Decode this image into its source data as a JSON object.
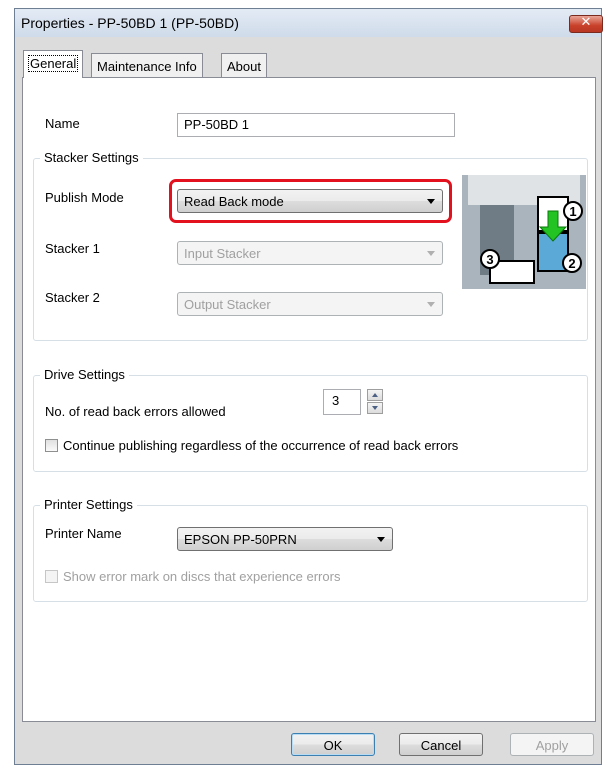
{
  "window": {
    "title": "Properties - PP-50BD 1 (PP-50BD)",
    "close_symbol": "✕"
  },
  "tabs": [
    {
      "label": "General",
      "active": true
    },
    {
      "label": "Maintenance Info",
      "active": false
    },
    {
      "label": "About",
      "active": false
    }
  ],
  "general": {
    "name_label": "Name",
    "name_value": "PP-50BD 1",
    "stacker": {
      "title": "Stacker Settings",
      "publish_mode_label": "Publish Mode",
      "publish_mode_value": "Read Back mode",
      "stacker1_label": "Stacker 1",
      "stacker1_value": "Input Stacker",
      "stacker2_label": "Stacker 2",
      "stacker2_value": "Output Stacker",
      "diagram_numbers": [
        "1",
        "2",
        "3"
      ]
    },
    "drive": {
      "title": "Drive Settings",
      "errors_label": "No. of read back errors allowed",
      "errors_value": "3",
      "continue_label": "Continue publishing regardless of the occurrence of read back errors",
      "continue_checked": false
    },
    "printer": {
      "title": "Printer Settings",
      "printer_name_label": "Printer Name",
      "printer_name_value": "EPSON PP-50PRN",
      "error_mark_label": "Show error mark on discs that experience errors",
      "error_mark_checked": false
    }
  },
  "buttons": {
    "ok": "OK",
    "cancel": "Cancel",
    "apply": "Apply"
  },
  "colors": {
    "highlight": "#e3101e",
    "arrow_green": "#22c322",
    "stacker_blue": "#5aa9d6"
  }
}
